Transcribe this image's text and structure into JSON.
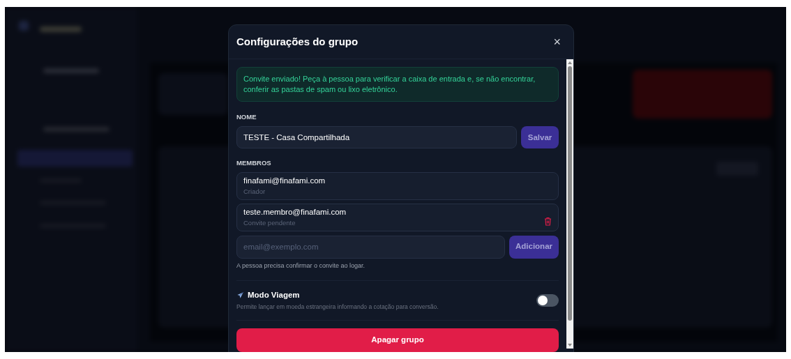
{
  "dialog": {
    "title": "Configurações do grupo",
    "close": "×"
  },
  "alert": "Convite enviado! Peça à pessoa para verificar a caixa de entrada e, se não encontrar, conferir as pastas de spam ou lixo eletrônico.",
  "name_section": {
    "label": "NOME",
    "value": "TESTE - Casa Compartilhada",
    "button": "Salvar"
  },
  "members_section": {
    "label": "MEMBROS",
    "members": [
      {
        "email": "finafami@finafami.com",
        "role": "Criador",
        "removable": false
      },
      {
        "email": "teste.membro@finafami.com",
        "role": "Convite pendente",
        "removable": true
      }
    ],
    "invite_placeholder": "email@exemplo.com",
    "invite_button": "Adicionar",
    "hint": "A pessoa precisa confirmar o convite ao logar."
  },
  "travel_mode": {
    "label": "Modo Viagem",
    "description": "Permite lançar em moeda estrangeira informando a cotação para conversão.",
    "on": false
  },
  "delete_button": "Apagar grupo"
}
